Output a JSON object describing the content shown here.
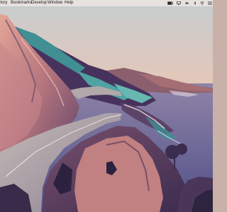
{
  "menubar": {
    "items": [
      "ntory",
      "Bookmarks",
      "Develop",
      "Window",
      "Help"
    ],
    "status_icons": [
      "battery-icon",
      "display-icon",
      "volume-icon",
      "bluetooth-icon",
      "wifi-icon",
      "control-center-icon"
    ]
  },
  "desktop": {
    "wallpaper": "coastal-highway-illustration",
    "colors": {
      "sky_top": "#c6cdd0",
      "sky_bottom": "#e7c9b4",
      "sea": "#6b6c98",
      "cliff_pink": "#c98a86",
      "cliff_purple": "#4d3a60",
      "teal_ridge": "#3f8f93",
      "road": "#a49d9a"
    }
  }
}
